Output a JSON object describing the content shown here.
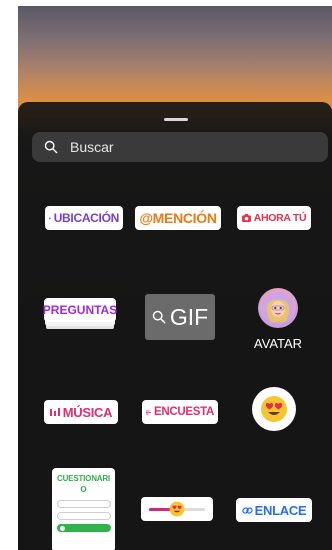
{
  "search": {
    "placeholder": "Buscar"
  },
  "stickers": {
    "ubicacion": "UBICACIÓN",
    "mencion": "@MENCIÓN",
    "ahora_tu": "AHORA TÚ",
    "preguntas": "PREGUNTAS",
    "gif": "GIF",
    "avatar": "AVATAR",
    "musica": "MÚSICA",
    "encuesta": "ENCUESTA",
    "cuestionario_title": "CUESTIONARI",
    "cuestionario_sub": "O",
    "enlace": "ENLACE"
  },
  "icons": {
    "search": "search-icon",
    "location": "location-pin-icon",
    "camera": "camera-icon",
    "music": "music-bars-icon",
    "poll": "poll-lines-icon",
    "link": "link-icon",
    "emoji": "heart-eyes-emoji-icon"
  },
  "colors": {
    "sheet": "#161616",
    "search_bg": "#3a3a3a",
    "ubicacion": "#7a3fc8",
    "mencion": "#f07a10",
    "ahora_tu": "#e8314f",
    "preguntas": "#a12ad6",
    "musica": "#e62c6e",
    "quiz": "#2fb34a",
    "enlace": "#2a6ef0"
  },
  "slider": {
    "value": 0.5
  }
}
